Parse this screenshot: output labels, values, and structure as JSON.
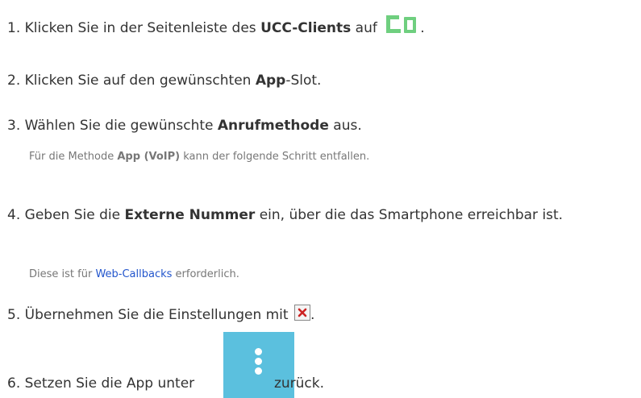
{
  "steps": [
    {
      "num": "1.",
      "before": "Klicken Sie in der Seitenleiste des ",
      "bold": "UCC-Clients",
      "after": " auf ",
      "tail": "."
    },
    {
      "num": "2.",
      "before": "Klicken Sie auf den gewünschten ",
      "bold": "App",
      "after": "-Slot."
    },
    {
      "num": "3.",
      "before": "Wählen Sie die gewünschte ",
      "bold": "Anrufmethode",
      "after": " aus."
    },
    {
      "num": "4.",
      "before": "Geben Sie die ",
      "bold": "Externe Nummer",
      "after": " ein, über die das Smartphone erreichbar ist."
    },
    {
      "num": "5.",
      "before": "Übernehmen Sie die Einstellungen mit ",
      "tail": "."
    },
    {
      "num": "6.",
      "before": "Setzen Sie die App unter ",
      "after": " zurück."
    }
  ],
  "notes": [
    {
      "before": "Für die Methode ",
      "bold": "App (VoIP)",
      "after": " kann der folgende Schritt entfallen."
    },
    {
      "before": "Diese ist für ",
      "link": "Web-Callbacks",
      "after": " erforderlich."
    }
  ],
  "icons": {
    "device": "devices-icon",
    "close": "close-icon",
    "menu": "kebab-menu-icon"
  },
  "colors": {
    "device_icon": "#6fcf7f",
    "close_icon": "#cc2222",
    "menu_button": "#5bc0de",
    "link": "#2255cc",
    "note_text": "#777777"
  }
}
